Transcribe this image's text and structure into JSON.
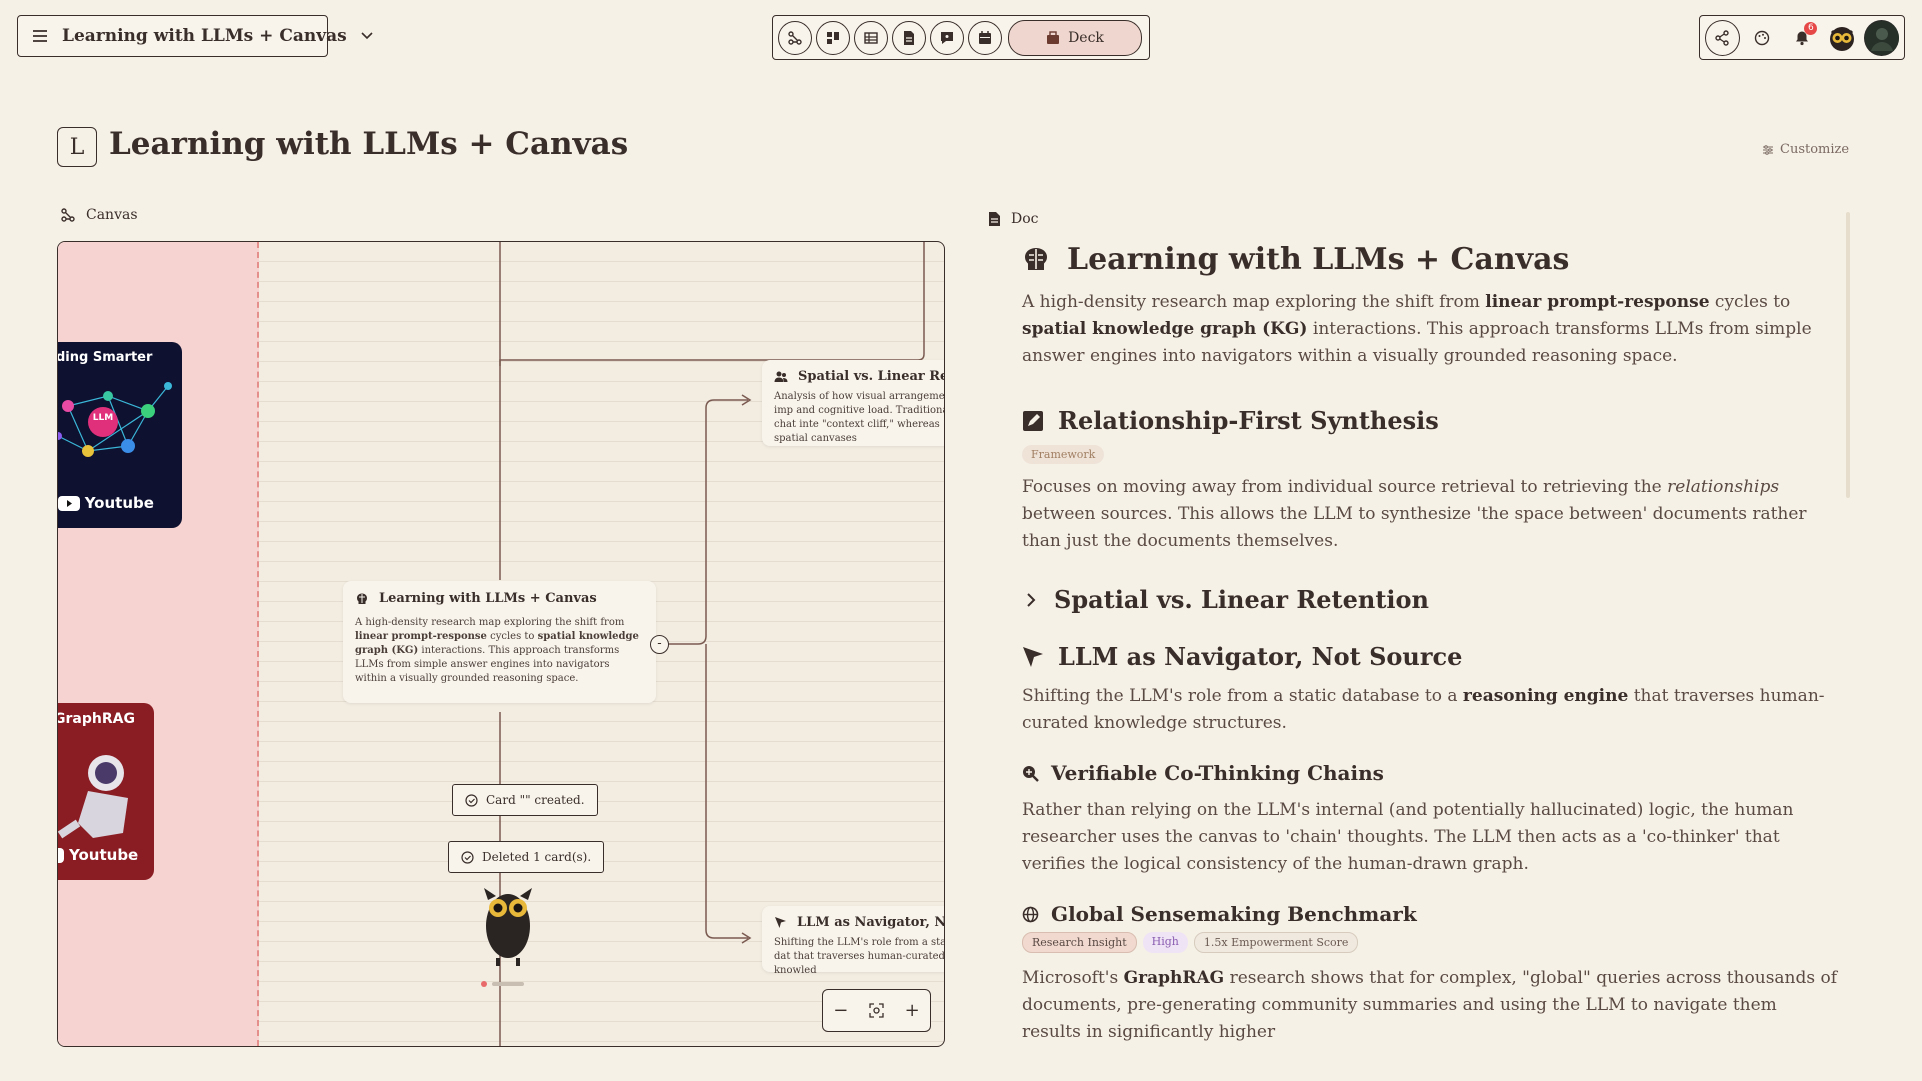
{
  "app": {
    "project_title": "Learning with LLMs + Canvas"
  },
  "toolbar": {
    "tools": [
      {
        "name": "mindmap-view-icon"
      },
      {
        "name": "board-view-icon"
      },
      {
        "name": "table-view-icon"
      },
      {
        "name": "doc-view-icon"
      },
      {
        "name": "chat-view-icon"
      },
      {
        "name": "calendar-view-icon"
      }
    ],
    "deck_label": "Deck"
  },
  "user_bar": {
    "notification_count": "6"
  },
  "header": {
    "logo_letter": "L",
    "title": "Learning with LLMs + Canvas",
    "customize_label": "Customize"
  },
  "canvas": {
    "label": "Canvas",
    "thumbnails": {
      "top": {
        "title": "ding Smarter",
        "chip": "LLM",
        "youtube_prefix": "n",
        "youtube_label": "Youtube"
      },
      "bottom": {
        "title": "GraphRAG",
        "youtube_label": "Youtube"
      }
    },
    "main_card": {
      "title": "Learning with LLMs + Canvas",
      "body_p1": "A high-density research map exploring the shift from ",
      "body_b1": "linear prompt-response",
      "body_p2": " cycles to ",
      "body_b2": "spatial knowledge graph (KG)",
      "body_p3": " interactions. This approach transforms LLMs from simple answer engines into navigators within a visually grounded reasoning space."
    },
    "card_spatial": {
      "title": "Spatial vs. Linear Retent",
      "body": "Analysis of how visual arrangement imp and cognitive load. Traditional chat inte \"context cliff,\" whereas spatial canvases"
    },
    "card_navigator": {
      "title": "LLM as Navigator, Not So",
      "body": "Shifting the LLM's role from a static dat that traverses human-curated knowled"
    },
    "collapse_symbol": "-",
    "toasts": {
      "created": "Card \"\" created.",
      "deleted": "Deleted 1 card(s)."
    },
    "zoom": {
      "minus": "−",
      "plus": "+"
    }
  },
  "doc": {
    "label": "Doc",
    "title": "Learning with LLMs + Canvas",
    "intro": {
      "p1": "A high-density research map exploring the shift from ",
      "b1": "linear prompt-response",
      "p2": " cycles to ",
      "b2": "spatial knowledge graph (KG)",
      "p3": " interactions. This approach transforms LLMs from simple answer engines into navigators within a visually grounded reasoning space."
    },
    "section1": {
      "title": "Relationship-First Synthesis",
      "tag": "Framework",
      "p1": "Focuses on moving away from individual source retrieval to retrieving the ",
      "i1": "relationships",
      "p2": " between sources. This allows the LLM to synthesize 'the space between' documents rather than just the documents themselves."
    },
    "section2": {
      "title": "Spatial vs. Linear Retention"
    },
    "section3": {
      "title": "LLM as Navigator, Not Source",
      "p1": "Shifting the LLM's role from a static database to a ",
      "b1": "reasoning engine",
      "p2": " that traverses human-curated knowledge structures."
    },
    "section4": {
      "title": "Verifiable Co-Thinking Chains",
      "body": "Rather than relying on the LLM's internal (and potentially hallucinated) logic, the human researcher uses the canvas to 'chain' thoughts. The LLM then acts as a 'co-thinker' that verifies the logical consistency of the human-drawn graph."
    },
    "section5": {
      "title": "Global Sensemaking Benchmark",
      "tags": [
        "Research Insight",
        "High",
        "1.5x Empowerment Score"
      ],
      "p1": "Microsoft's ",
      "b1": "GraphRAG",
      "p2": " research shows that for complex, \"global\" queries across thousands of documents, pre-generating community summaries and using the LLM to navigate them results in significantly higher"
    }
  }
}
